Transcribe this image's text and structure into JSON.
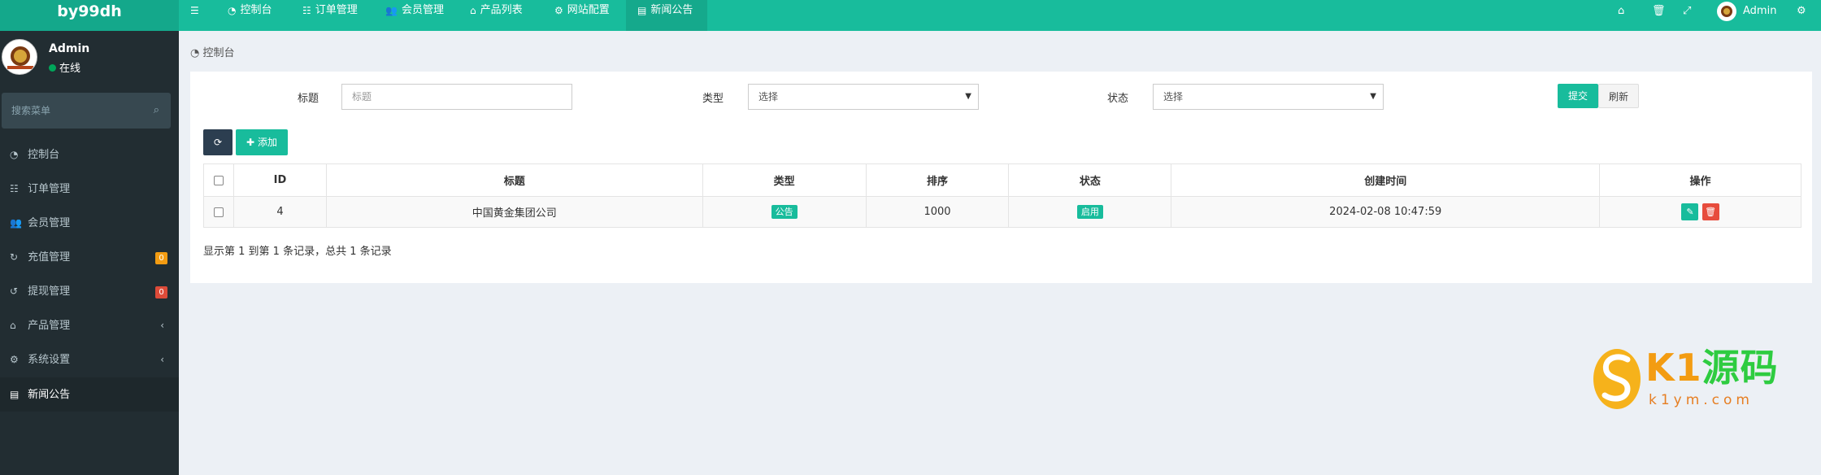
{
  "app": {
    "logo": "by99dh"
  },
  "topnav": {
    "items": [
      {
        "icon": "menu-icon",
        "label": ""
      },
      {
        "icon": "dashboard-icon",
        "label": "控制台"
      },
      {
        "icon": "list-icon",
        "label": "订单管理"
      },
      {
        "icon": "users-icon",
        "label": "会员管理"
      },
      {
        "icon": "product-icon",
        "label": "产品列表"
      },
      {
        "icon": "cogs-icon",
        "label": "网站配置"
      },
      {
        "icon": "news-icon",
        "label": "新闻公告"
      }
    ],
    "admin_label": "Admin"
  },
  "sidebar": {
    "user": {
      "name": "Admin",
      "status": "在线"
    },
    "search": {
      "placeholder": "搜索菜单"
    },
    "items": [
      {
        "label": "控制台",
        "icon": "dashboard-icon"
      },
      {
        "label": "订单管理",
        "icon": "list-icon"
      },
      {
        "label": "会员管理",
        "icon": "users-icon"
      },
      {
        "label": "充值管理",
        "icon": "recharge-icon",
        "badge": "0",
        "badge_color": "#f39c12"
      },
      {
        "label": "提现管理",
        "icon": "withdraw-icon",
        "badge": "0",
        "badge_color": "#dd4b39"
      },
      {
        "label": "产品管理",
        "icon": "product-icon"
      },
      {
        "label": "系统设置",
        "icon": "cogs-icon"
      },
      {
        "label": "新闻公告",
        "icon": "news-icon"
      }
    ]
  },
  "breadcrumb": {
    "label": "控制台"
  },
  "filters": {
    "title_label": "标题",
    "title_placeholder": "标题",
    "type_label": "类型",
    "type_value": "选择",
    "status_label": "状态",
    "status_value": "选择",
    "submit_label": "提交",
    "reset_label": "刷新"
  },
  "toolbar": {
    "add_label": "添加"
  },
  "table": {
    "columns": [
      "ID",
      "标题",
      "类型",
      "排序",
      "状态",
      "创建时间",
      "操作"
    ],
    "rows": [
      {
        "id": "4",
        "title": "中国黄金集团公司",
        "type": "公告",
        "sort": "1000",
        "status": "启用",
        "created": "2024-02-08 10:47:59"
      }
    ],
    "footer": "显示第 1 到第 1 条记录，总共 1 条记录"
  },
  "watermark": {
    "big_a": "K1",
    "big_b": "源码",
    "small": "k1ym.com"
  },
  "colors": {
    "accent": "#18bc9c",
    "sidebar": "#222d32",
    "danger": "#dd4b39",
    "warning": "#f39c12"
  }
}
